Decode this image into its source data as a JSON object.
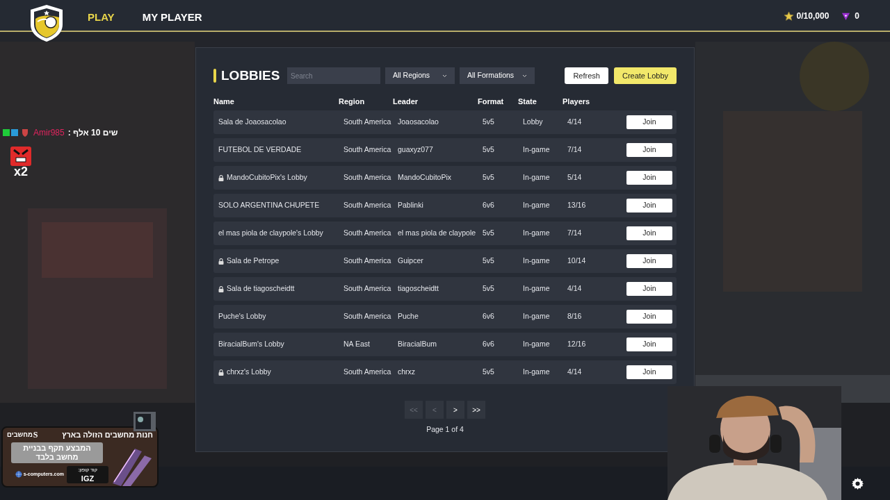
{
  "nav": {
    "items": [
      {
        "label": "PLAY",
        "selected": true
      },
      {
        "label": "MY PLAYER",
        "selected": false
      }
    ]
  },
  "currency": {
    "stars": "0/10,000",
    "gems": "0"
  },
  "lobbies": {
    "title": "LOBBIES",
    "search": {
      "placeholder": "Search"
    },
    "filters": [
      "All Regions",
      "All Formations"
    ],
    "buttons": [
      {
        "label": "Refresh",
        "kind": "plain"
      },
      {
        "label": "Create Lobby",
        "kind": "primary"
      }
    ],
    "columns": [
      "Name",
      "Region",
      "Leader",
      "Format",
      "State",
      "Players"
    ],
    "rows": [
      {
        "name": "Sala de Joaosacolao",
        "locked": false,
        "region": "South America",
        "leader": "Joaosacolao",
        "format": "5v5",
        "state": "Lobby",
        "players": "4/14",
        "action": "Join"
      },
      {
        "name": "FUTEBOL DE VERDADE",
        "locked": false,
        "region": "South America",
        "leader": "guaxyz077",
        "format": "5v5",
        "state": "In-game",
        "players": "7/14",
        "action": "Join"
      },
      {
        "name": "MandoCubitoPix's Lobby",
        "locked": true,
        "region": "South America",
        "leader": "MandoCubitoPix",
        "format": "5v5",
        "state": "In-game",
        "players": "5/14",
        "action": "Join"
      },
      {
        "name": "SOLO ARGENTINA CHUPETE",
        "locked": false,
        "region": "South America",
        "leader": "Pablinki",
        "format": "6v6",
        "state": "In-game",
        "players": "13/16",
        "action": "Join"
      },
      {
        "name": "el mas piola de claypole's Lobby",
        "locked": false,
        "region": "South America",
        "leader": "el mas piola de claypole",
        "format": "5v5",
        "state": "In-game",
        "players": "7/14",
        "action": "Join"
      },
      {
        "name": "Sala de Petrope",
        "locked": true,
        "region": "South America",
        "leader": "Guipcer",
        "format": "5v5",
        "state": "In-game",
        "players": "10/14",
        "action": "Join"
      },
      {
        "name": "Sala de tiagoscheidtt",
        "locked": true,
        "region": "South America",
        "leader": "tiagoscheidtt",
        "format": "5v5",
        "state": "In-game",
        "players": "4/14",
        "action": "Join"
      },
      {
        "name": "Puche's Lobby",
        "locked": false,
        "region": "South America",
        "leader": "Puche",
        "format": "6v6",
        "state": "In-game",
        "players": "8/16",
        "action": "Join"
      },
      {
        "name": "BiracialBum's Lobby",
        "locked": false,
        "region": "NA East",
        "leader": "BiracialBum",
        "format": "6v6",
        "state": "In-game",
        "players": "12/16",
        "action": "Join"
      },
      {
        "name": "chrxz's Lobby",
        "locked": true,
        "region": "South America",
        "leader": "chrxz",
        "format": "5v5",
        "state": "In-game",
        "players": "4/14",
        "action": "Join"
      }
    ],
    "pagination": {
      "buttons": [
        {
          "label": "<<",
          "disabled": true
        },
        {
          "label": "<",
          "disabled": true
        },
        {
          "label": ">",
          "disabled": false
        },
        {
          "label": ">>",
          "disabled": false
        }
      ],
      "page": "Page 1 of 4"
    }
  },
  "chat": {
    "user": "Amir985",
    "message": ": שים 10 אלף",
    "emote_count": "x2"
  },
  "ad": {
    "headline": "חנות מחשבים הזולה בארץ",
    "brand_letter": "S",
    "brand": "מחשבים",
    "offer": "המבצע תקף בבניית מחשב בלבד",
    "coupon_label": "קוד קופון:",
    "coupon": "IGZ",
    "site": "s-computers.com"
  }
}
